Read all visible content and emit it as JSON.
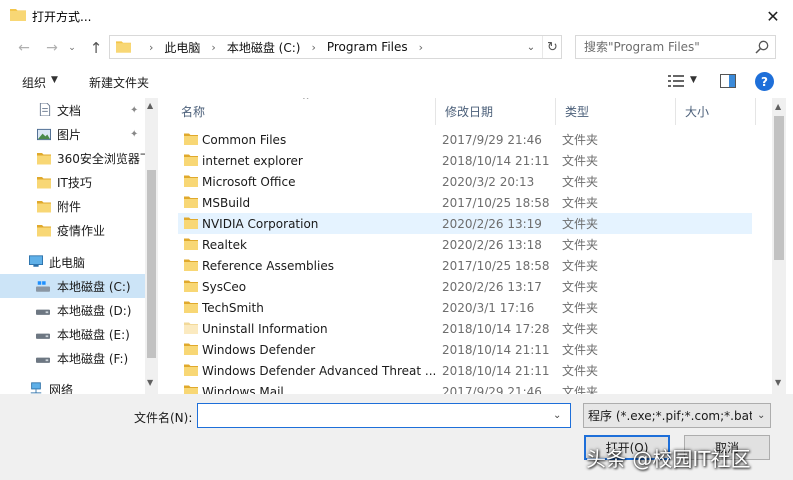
{
  "window": {
    "title": "打开方式...",
    "close_glyph": "✕"
  },
  "nav": {
    "back_glyph": "←",
    "forward_glyph": "→",
    "recent_glyph": "⌄",
    "up_glyph": "↑"
  },
  "address": {
    "segments": [
      "此电脑",
      "本地磁盘 (C:)",
      "Program Files"
    ],
    "separator": "›",
    "dropdown_glyph": "⌄",
    "refresh_glyph": "↻"
  },
  "search": {
    "placeholder": "搜索\"Program Files\""
  },
  "toolbar": {
    "organize_label": "组织",
    "organize_arrow": "▼",
    "new_folder_label": "新建文件夹",
    "view_arrow": "▼",
    "help_label": "?"
  },
  "sidebar": {
    "pin_glyph": "📌",
    "items": [
      {
        "label": "文档",
        "icon": "document-icon",
        "pinned": true
      },
      {
        "label": "图片",
        "icon": "pictures-icon",
        "pinned": true
      },
      {
        "label": "360安全浏览器下",
        "icon": "folder-icon",
        "pinned": false
      },
      {
        "label": "IT技巧",
        "icon": "folder-icon",
        "pinned": false
      },
      {
        "label": "附件",
        "icon": "folder-icon",
        "pinned": false
      },
      {
        "label": "疫情作业",
        "icon": "folder-icon",
        "pinned": false
      },
      {
        "label": "此电脑",
        "icon": "computer-icon",
        "pinned": false
      },
      {
        "label": "本地磁盘 (C:)",
        "icon": "windows-drive-icon",
        "pinned": false,
        "selected": true
      },
      {
        "label": "本地磁盘 (D:)",
        "icon": "drive-icon",
        "pinned": false
      },
      {
        "label": "本地磁盘 (E:)",
        "icon": "drive-icon",
        "pinned": false
      },
      {
        "label": "本地磁盘 (F:)",
        "icon": "drive-icon",
        "pinned": false
      },
      {
        "label": "网络",
        "icon": "network-icon",
        "pinned": false
      }
    ]
  },
  "filelist": {
    "columns": [
      "名称",
      "修改日期",
      "类型",
      "大小"
    ],
    "sort_glyph": "^",
    "rows": [
      {
        "name": "Common Files",
        "date": "2017/9/29 21:46",
        "type": "文件夹"
      },
      {
        "name": "internet explorer",
        "date": "2018/10/14 21:11",
        "type": "文件夹"
      },
      {
        "name": "Microsoft Office",
        "date": "2020/3/2 20:13",
        "type": "文件夹"
      },
      {
        "name": "MSBuild",
        "date": "2017/10/25 18:58",
        "type": "文件夹"
      },
      {
        "name": "NVIDIA Corporation",
        "date": "2020/2/26 13:19",
        "type": "文件夹",
        "hover": true
      },
      {
        "name": "Realtek",
        "date": "2020/2/26 13:18",
        "type": "文件夹"
      },
      {
        "name": "Reference Assemblies",
        "date": "2017/10/25 18:58",
        "type": "文件夹"
      },
      {
        "name": "SysCeo",
        "date": "2020/2/26 13:17",
        "type": "文件夹"
      },
      {
        "name": "TechSmith",
        "date": "2020/3/1 17:16",
        "type": "文件夹"
      },
      {
        "name": "Uninstall Information",
        "date": "2018/10/14 17:28",
        "type": "文件夹",
        "faded": true
      },
      {
        "name": "Windows Defender",
        "date": "2018/10/14 21:11",
        "type": "文件夹"
      },
      {
        "name": "Windows Defender Advanced Threat ...",
        "date": "2018/10/14 21:11",
        "type": "文件夹"
      },
      {
        "name": "Windows Mail",
        "date": "2017/9/29 21:46",
        "type": "文件夹"
      }
    ]
  },
  "bottom": {
    "filename_label": "文件名(N):",
    "filename_value": "",
    "filename_dropdown": "⌄",
    "filetype_value": "程序 (*.exe;*.pif;*.com;*.bat;*.",
    "filetype_arrow": "⌄",
    "open_label": "打开(O)",
    "cancel_label": "取消"
  },
  "scroll": {
    "up_glyph": "▲",
    "down_glyph": "▼"
  },
  "watermark": {
    "text": "头条 @校园IT社区"
  },
  "colors": {
    "accent": "#1e6fd9",
    "folder": "#f3c64c",
    "folder_dark": "#e0a92c",
    "selected": "#cce4f7",
    "hover": "#e5f3ff"
  }
}
